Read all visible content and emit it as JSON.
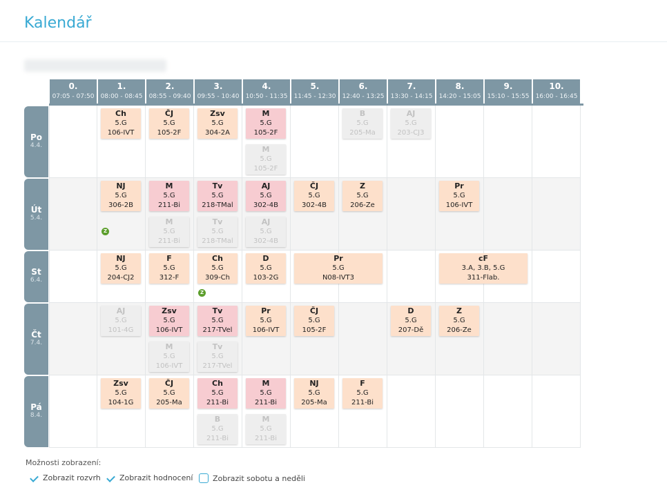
{
  "page": {
    "title": "Kalendář"
  },
  "periods": [
    {
      "num": "0.",
      "time": "07:05 - 07:50"
    },
    {
      "num": "1.",
      "time": "08:00 - 08:45"
    },
    {
      "num": "2.",
      "time": "08:55 - 09:40"
    },
    {
      "num": "3.",
      "time": "09:55 - 10:40"
    },
    {
      "num": "4.",
      "time": "10:50 - 11:35"
    },
    {
      "num": "5.",
      "time": "11:45 - 12:30"
    },
    {
      "num": "6.",
      "time": "12:40 - 13:25"
    },
    {
      "num": "7.",
      "time": "13:30 - 14:15"
    },
    {
      "num": "8.",
      "time": "14:20 - 15:05"
    },
    {
      "num": "9.",
      "time": "15:10 - 15:55"
    },
    {
      "num": "10.",
      "time": "16:00 - 16:45"
    }
  ],
  "days": [
    {
      "name": "Po",
      "date": "4.4."
    },
    {
      "name": "Út",
      "date": "5.4."
    },
    {
      "name": "St",
      "date": "6.4."
    },
    {
      "name": "Čt",
      "date": "7.4."
    },
    {
      "name": "Pá",
      "date": "8.4."
    }
  ],
  "lessons": [
    {
      "day": 0,
      "period": 1,
      "slot": 0,
      "span": 1,
      "subject": "Ch",
      "group": "5.G",
      "room": "106-IVT",
      "style": "o"
    },
    {
      "day": 0,
      "period": 2,
      "slot": 0,
      "span": 1,
      "subject": "ČJ",
      "group": "5.G",
      "room": "105-2F",
      "style": "o"
    },
    {
      "day": 0,
      "period": 3,
      "slot": 0,
      "span": 1,
      "subject": "Zsv",
      "group": "5.G",
      "room": "304-2A",
      "style": "o"
    },
    {
      "day": 0,
      "period": 4,
      "slot": 0,
      "span": 1,
      "subject": "M",
      "group": "5.G",
      "room": "105-2F",
      "style": "p"
    },
    {
      "day": 0,
      "period": 4,
      "slot": 1,
      "span": 1,
      "subject": "M",
      "group": "5.G",
      "room": "105-2F",
      "style": "g"
    },
    {
      "day": 0,
      "period": 6,
      "slot": 0,
      "span": 1,
      "subject": "B",
      "group": "5.G",
      "room": "205-Ma",
      "style": "g"
    },
    {
      "day": 0,
      "period": 7,
      "slot": 0,
      "span": 1,
      "subject": "AJ",
      "group": "5.G",
      "room": "203-CJ3",
      "style": "g"
    },
    {
      "day": 1,
      "period": 1,
      "slot": 0,
      "span": 1,
      "subject": "NJ",
      "group": "5.G",
      "room": "306-2B",
      "style": "o"
    },
    {
      "day": 1,
      "period": 2,
      "slot": 0,
      "span": 1,
      "subject": "M",
      "group": "5.G",
      "room": "211-Bi",
      "style": "p"
    },
    {
      "day": 1,
      "period": 2,
      "slot": 1,
      "span": 1,
      "subject": "M",
      "group": "5.G",
      "room": "211-Bi",
      "style": "g"
    },
    {
      "day": 1,
      "period": 3,
      "slot": 0,
      "span": 1,
      "subject": "Tv",
      "group": "5.G",
      "room": "218-TMal",
      "style": "p"
    },
    {
      "day": 1,
      "period": 3,
      "slot": 1,
      "span": 1,
      "subject": "Tv",
      "group": "5.G",
      "room": "218-TMal",
      "style": "g"
    },
    {
      "day": 1,
      "period": 4,
      "slot": 0,
      "span": 1,
      "subject": "AJ",
      "group": "5.G",
      "room": "302-4B",
      "style": "p"
    },
    {
      "day": 1,
      "period": 4,
      "slot": 1,
      "span": 1,
      "subject": "AJ",
      "group": "5.G",
      "room": "302-4B",
      "style": "g"
    },
    {
      "day": 1,
      "period": 5,
      "slot": 0,
      "span": 1,
      "subject": "ČJ",
      "group": "5.G",
      "room": "302-4B",
      "style": "o"
    },
    {
      "day": 1,
      "period": 6,
      "slot": 0,
      "span": 1,
      "subject": "Z",
      "group": "5.G",
      "room": "206-Ze",
      "style": "o"
    },
    {
      "day": 1,
      "period": 8,
      "slot": 0,
      "span": 1,
      "subject": "Pr",
      "group": "5.G",
      "room": "106-IVT",
      "style": "o"
    },
    {
      "day": 2,
      "period": 1,
      "slot": 0,
      "span": 1,
      "subject": "NJ",
      "group": "5.G",
      "room": "204-CJ2",
      "style": "o"
    },
    {
      "day": 2,
      "period": 2,
      "slot": 0,
      "span": 1,
      "subject": "F",
      "group": "5.G",
      "room": "312-F",
      "style": "o"
    },
    {
      "day": 2,
      "period": 3,
      "slot": 0,
      "span": 1,
      "subject": "Ch",
      "group": "5.G",
      "room": "309-Ch",
      "style": "o"
    },
    {
      "day": 2,
      "period": 4,
      "slot": 0,
      "span": 1,
      "subject": "D",
      "group": "5.G",
      "room": "103-2G",
      "style": "o"
    },
    {
      "day": 2,
      "period": 5,
      "slot": 0,
      "span": 2,
      "subject": "Pr",
      "group": "5.G",
      "room": "N08-IVT3",
      "style": "o"
    },
    {
      "day": 2,
      "period": 8,
      "slot": 0,
      "span": 2,
      "subject": "cF",
      "group": "3.A, 3.B, 5.G",
      "room": "311-Flab.",
      "style": "o"
    },
    {
      "day": 3,
      "period": 1,
      "slot": 0,
      "span": 1,
      "subject": "AJ",
      "group": "5.G",
      "room": "101-4G",
      "style": "g"
    },
    {
      "day": 3,
      "period": 2,
      "slot": 0,
      "span": 1,
      "subject": "Zsv",
      "group": "5.G",
      "room": "106-IVT",
      "style": "p"
    },
    {
      "day": 3,
      "period": 2,
      "slot": 1,
      "span": 1,
      "subject": "M",
      "group": "5.G",
      "room": "106-IVT",
      "style": "g"
    },
    {
      "day": 3,
      "period": 3,
      "slot": 0,
      "span": 1,
      "subject": "Tv",
      "group": "5.G",
      "room": "217-TVel",
      "style": "p"
    },
    {
      "day": 3,
      "period": 3,
      "slot": 1,
      "span": 1,
      "subject": "Tv",
      "group": "5.G",
      "room": "217-TVel",
      "style": "g"
    },
    {
      "day": 3,
      "period": 4,
      "slot": 0,
      "span": 1,
      "subject": "Pr",
      "group": "5.G",
      "room": "106-IVT",
      "style": "o"
    },
    {
      "day": 3,
      "period": 5,
      "slot": 0,
      "span": 1,
      "subject": "ČJ",
      "group": "5.G",
      "room": "105-2F",
      "style": "o"
    },
    {
      "day": 3,
      "period": 7,
      "slot": 0,
      "span": 1,
      "subject": "D",
      "group": "5.G",
      "room": "207-Dě",
      "style": "o"
    },
    {
      "day": 3,
      "period": 8,
      "slot": 0,
      "span": 1,
      "subject": "Z",
      "group": "5.G",
      "room": "206-Ze",
      "style": "o"
    },
    {
      "day": 4,
      "period": 1,
      "slot": 0,
      "span": 1,
      "subject": "Zsv",
      "group": "5.G",
      "room": "104-1G",
      "style": "o"
    },
    {
      "day": 4,
      "period": 2,
      "slot": 0,
      "span": 1,
      "subject": "ČJ",
      "group": "5.G",
      "room": "205-Ma",
      "style": "o"
    },
    {
      "day": 4,
      "period": 3,
      "slot": 0,
      "span": 1,
      "subject": "Ch",
      "group": "5.G",
      "room": "211-Bi",
      "style": "p"
    },
    {
      "day": 4,
      "period": 3,
      "slot": 1,
      "span": 1,
      "subject": "B",
      "group": "5.G",
      "room": "211-Bi",
      "style": "g"
    },
    {
      "day": 4,
      "period": 4,
      "slot": 0,
      "span": 1,
      "subject": "M",
      "group": "5.G",
      "room": "211-Bi",
      "style": "p"
    },
    {
      "day": 4,
      "period": 4,
      "slot": 1,
      "span": 1,
      "subject": "M",
      "group": "5.G",
      "room": "211-Bi",
      "style": "g"
    },
    {
      "day": 4,
      "period": 5,
      "slot": 0,
      "span": 1,
      "subject": "NJ",
      "group": "5.G",
      "room": "205-Ma",
      "style": "o"
    },
    {
      "day": 4,
      "period": 6,
      "slot": 0,
      "span": 1,
      "subject": "F",
      "group": "5.G",
      "room": "211-Bi",
      "style": "o"
    }
  ],
  "grades": [
    {
      "day": 1,
      "period": 1,
      "label": "Z"
    },
    {
      "day": 2,
      "period": 3,
      "label": "Z"
    }
  ],
  "options": {
    "label": "Možnosti zobrazení:",
    "items": [
      {
        "label": "Zobrazit rozvrh",
        "checked": true
      },
      {
        "label": "Zobrazit hodnocení",
        "checked": true
      },
      {
        "label": "Zobrazit sobotu a neděli",
        "checked": false
      }
    ]
  },
  "colors": {
    "accent": "#38a9d3",
    "header": "#7e97a4",
    "lesson": "#fde0cb",
    "changed": "#f7ccd1",
    "cancelled": "#eeeeee",
    "grade": "#5c9e2c"
  }
}
